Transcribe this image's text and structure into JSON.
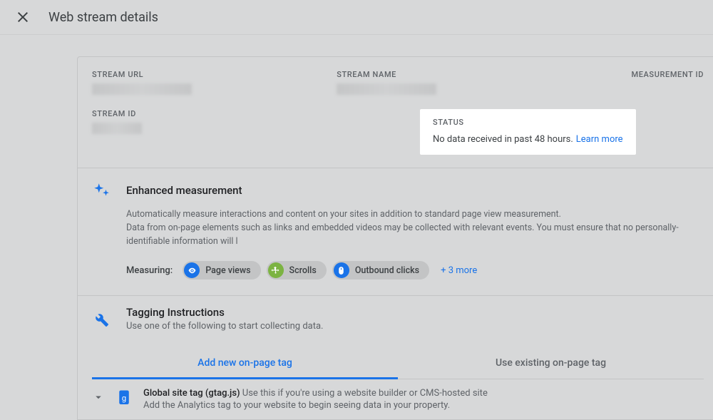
{
  "header": {
    "title": "Web stream details"
  },
  "fields": {
    "stream_url_label": "STREAM URL",
    "stream_name_label": "STREAM NAME",
    "measurement_id_label": "MEASUREMENT ID",
    "stream_id_label": "STREAM ID"
  },
  "status": {
    "label": "STATUS",
    "message": "No data received in past 48 hours.",
    "learn_more": "Learn more"
  },
  "enhanced": {
    "title": "Enhanced measurement",
    "desc1": "Automatically measure interactions and content on your sites in addition to standard page view measurement.",
    "desc2": "Data from on-page elements such as links and embedded videos may be collected with relevant events. You must ensure that no personally-identifiable information will l",
    "measuring_label": "Measuring:",
    "pills": [
      {
        "label": "Page views"
      },
      {
        "label": "Scrolls"
      },
      {
        "label": "Outbound clicks"
      }
    ],
    "more": "+ 3 more"
  },
  "tagging": {
    "title": "Tagging Instructions",
    "subtitle": "Use one of the following to start collecting data.",
    "tab1": "Add new on-page tag",
    "tab2": "Use existing on-page tag",
    "gtag_title": "Global site tag (gtag.js) ",
    "gtag_hint": "Use this if you're using a website builder or CMS-hosted site",
    "gtag_sub": "Add the Analytics tag to your website to begin seeing data in your property."
  }
}
